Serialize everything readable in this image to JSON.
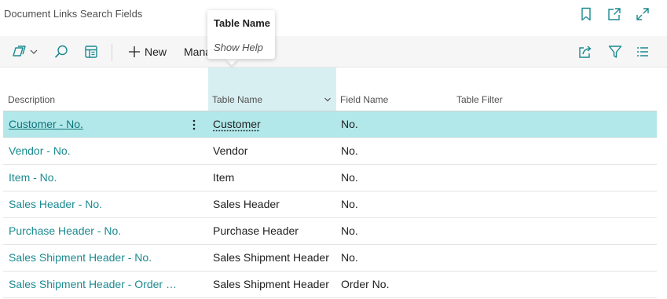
{
  "page": {
    "title": "Document Links Search Fields"
  },
  "header_icons": [
    "bookmark-icon",
    "open-new-window-icon",
    "expand-icon"
  ],
  "action_bar": {
    "new_label": "New",
    "manage_label": "Mana"
  },
  "tooltip": {
    "title": "Table Name",
    "help": "Show Help"
  },
  "columns": {
    "description": "Description",
    "table_name": "Table Name",
    "field_name": "Field Name",
    "table_filter": "Table Filter"
  },
  "rows": [
    {
      "description": "Customer - No.",
      "table_name": "Customer",
      "field_name": "No.",
      "table_filter": ""
    },
    {
      "description": "Vendor - No.",
      "table_name": "Vendor",
      "field_name": "No.",
      "table_filter": ""
    },
    {
      "description": "Item - No.",
      "table_name": "Item",
      "field_name": "No.",
      "table_filter": ""
    },
    {
      "description": "Sales Header - No.",
      "table_name": "Sales Header",
      "field_name": "No.",
      "table_filter": ""
    },
    {
      "description": "Purchase Header - No.",
      "table_name": "Purchase Header",
      "field_name": "No.",
      "table_filter": ""
    },
    {
      "description": "Sales Shipment Header - No.",
      "table_name": "Sales Shipment Header",
      "field_name": "No.",
      "table_filter": ""
    },
    {
      "description": "Sales Shipment Header - Order No.",
      "table_name": "Sales Shipment Header",
      "field_name": "Order No.",
      "table_filter": ""
    }
  ],
  "colors": {
    "accent": "#1b8a8f",
    "selected_row": "#b2e8ea",
    "column_highlight": "#d8eff1"
  }
}
